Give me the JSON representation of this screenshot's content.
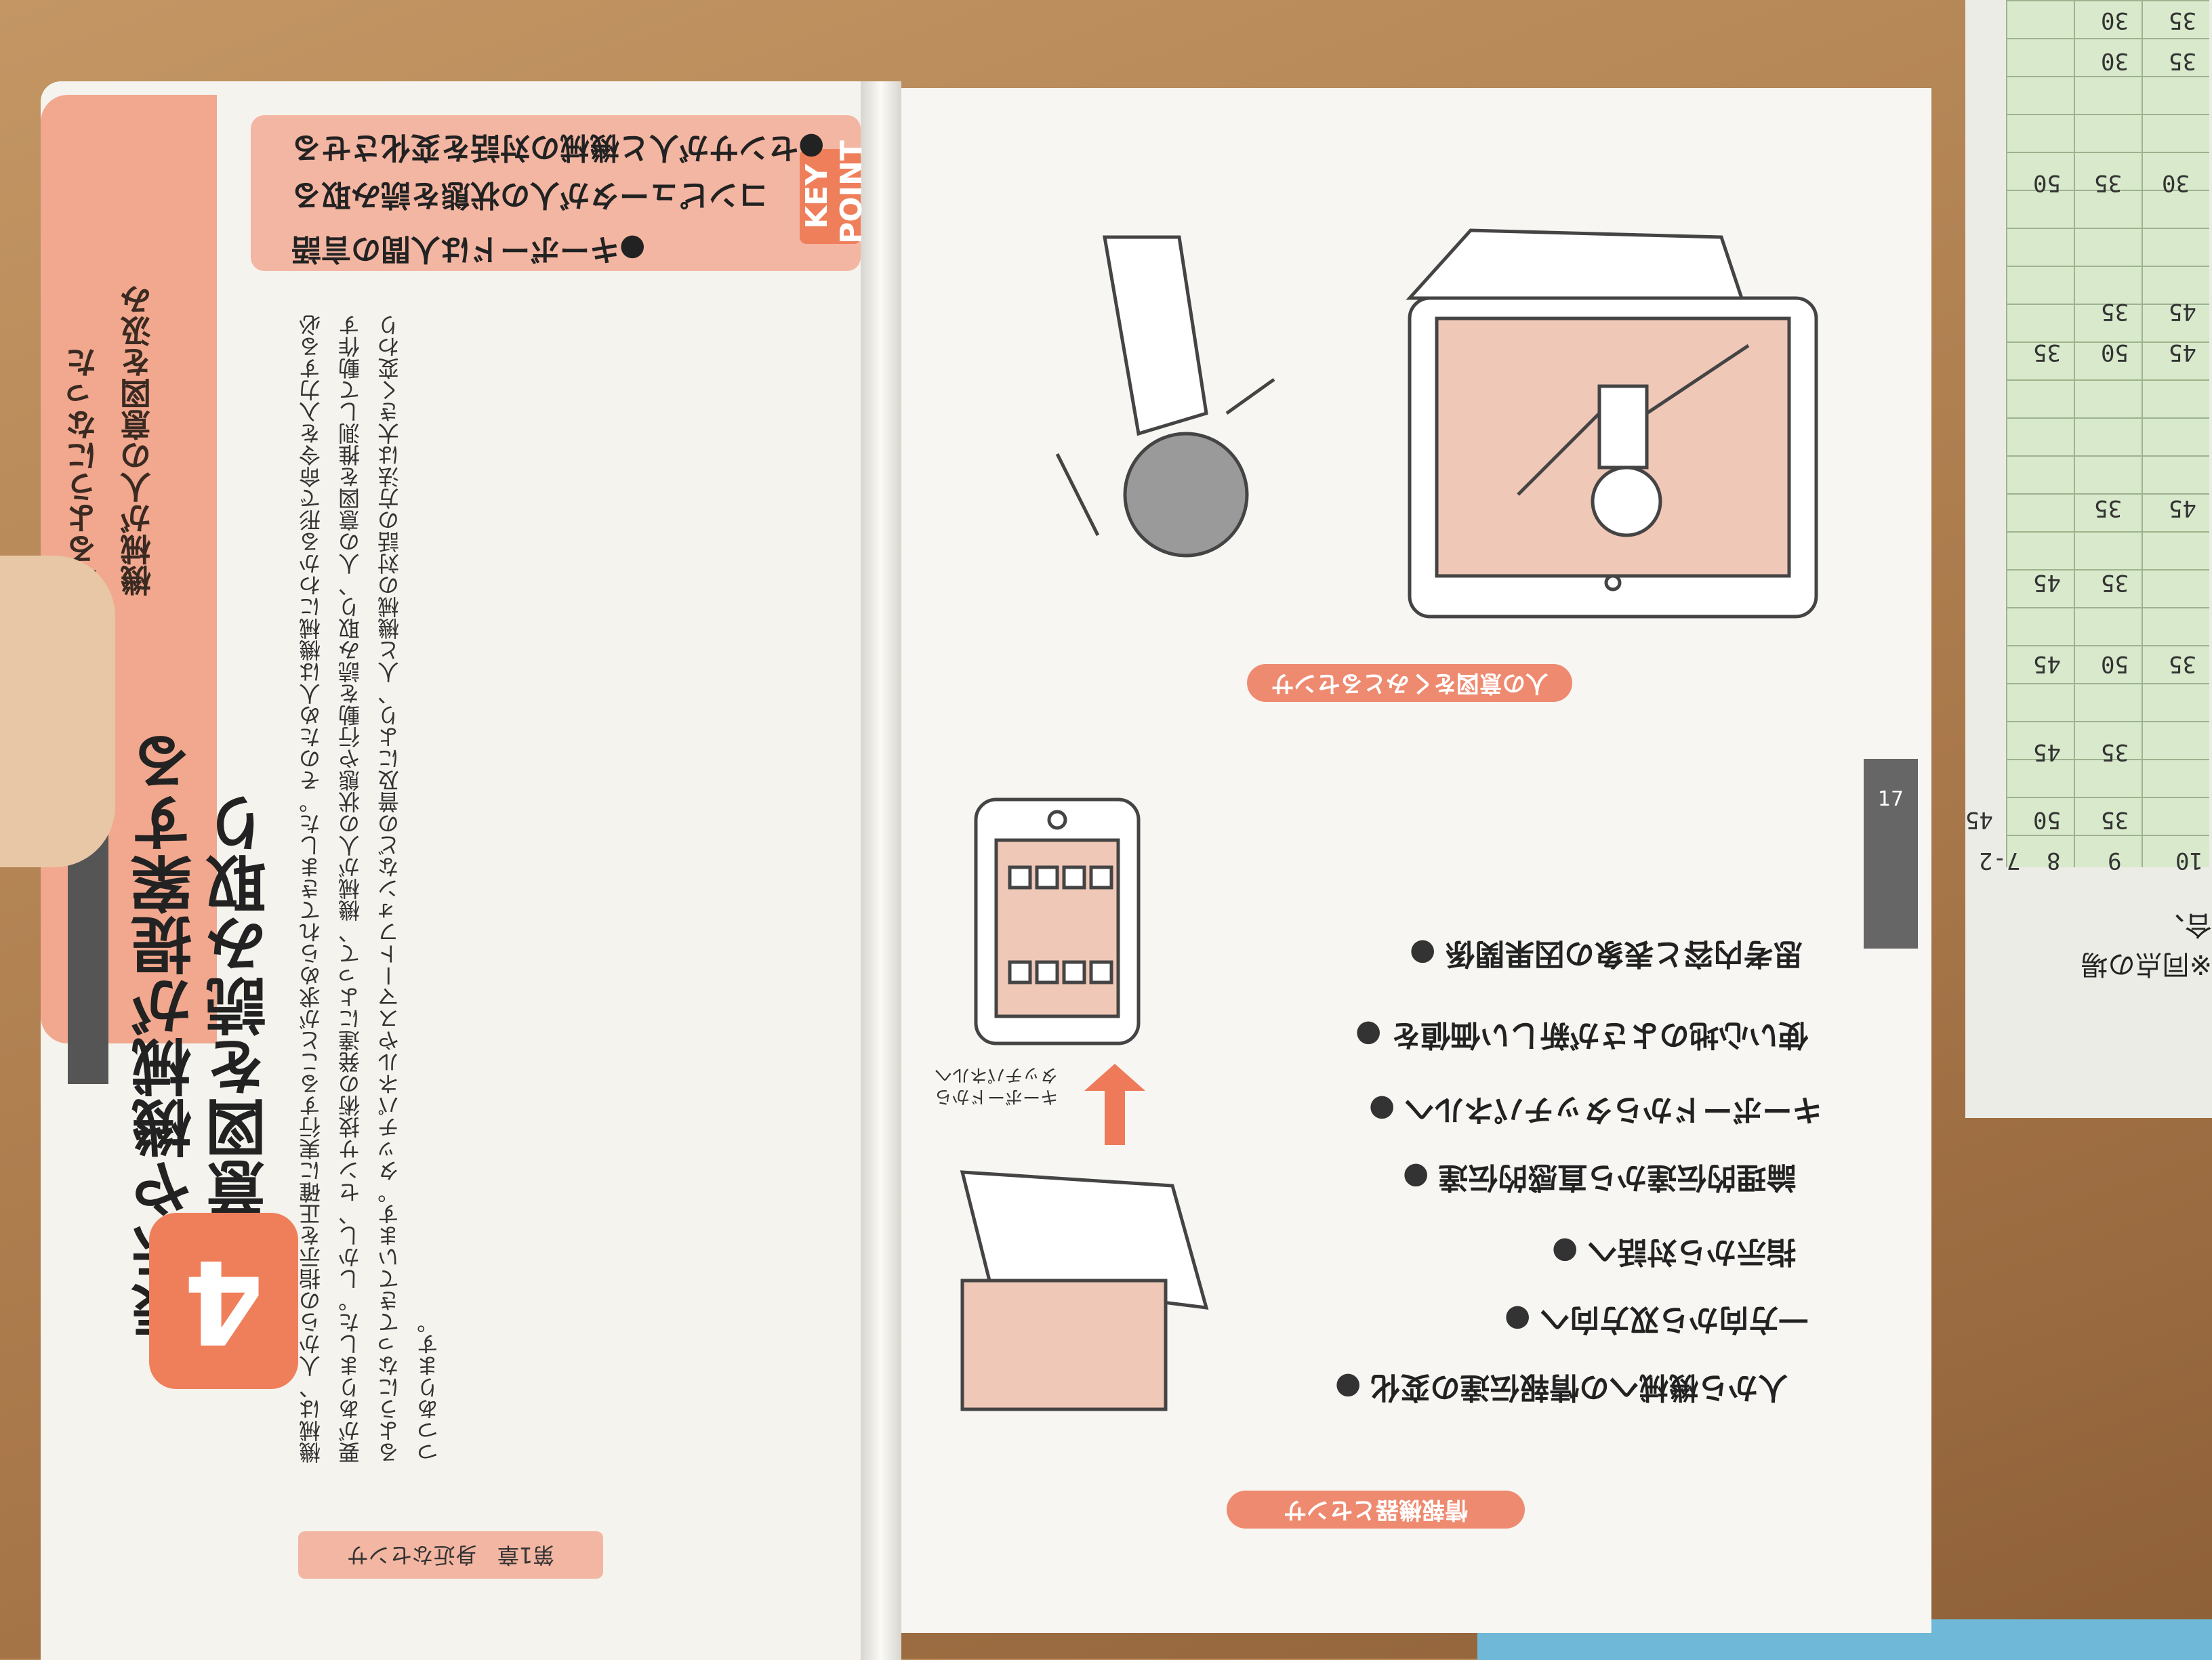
{
  "left_page": {
    "chapter_number": "4",
    "side_heading_lines": [
      "機械が人の意図を汲み",
      "取るようになった"
    ],
    "main_heading_lines": [
      "人の意図を読み取り",
      "表示や機械が提案する"
    ],
    "key_point_tag": "KEY POINT",
    "key_points": [
      "●キーボードは人間の言語",
      "コンピュータが人の状態を読み取る",
      "●センサが人と機械の対話を変化させる"
    ],
    "body_text": "機械は、人からの指示を正確に実行することが求められてきました。そのため人は機械にわかる形で命令を入力する必要がありました。しかし、センサ技術の発達によって、機械が人の状態や行動を読み取り、人の意図を推測して動作するようになってきています。タッチパネルやスマートフォンなどの普及により、人と機械の対話の方法は大きく変わりつつあります。",
    "footer": {
      "chapter": "第1章",
      "title": "身近なセンサ"
    }
  },
  "right_page": {
    "page_number": "17",
    "sensor_pill": "情報機器とセンサ",
    "intent_pill": "人の意図をくみとるセンサ",
    "bullets": [
      "人から機械への情報伝達の変化",
      "一方向から双方向へ",
      "指示から対話へ",
      "論理的伝達から直感的伝達",
      "キーボードからタッチパネルへ",
      "使い心地のよさが新しい価値を",
      "思考内容と表象の因果関係"
    ],
    "tablet_label": "キーボードから タッチパネルへ"
  },
  "background_sheet": {
    "grid_numbers": [
      "35",
      "30",
      "35",
      "30",
      "50",
      "35",
      "30",
      "45",
      "35",
      "45",
      "50",
      "35",
      "45",
      "35",
      "45",
      "35",
      "45",
      "50",
      "35",
      "45",
      "35",
      "45",
      "50",
      "35"
    ],
    "grid_footer": [
      "7-2",
      "8",
      "9",
      "10"
    ],
    "note": "※同点の場合、"
  }
}
